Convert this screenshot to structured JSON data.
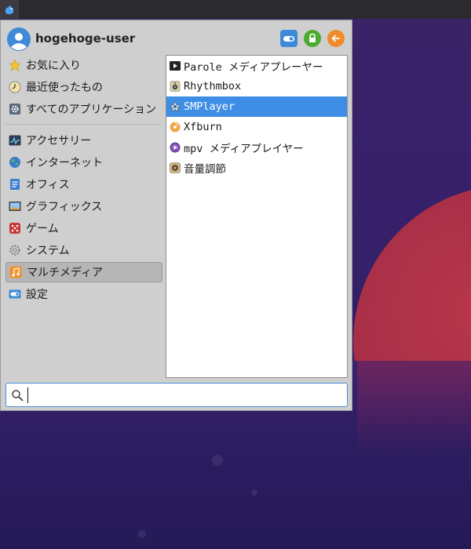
{
  "user": {
    "name": "hogehoge-user"
  },
  "header_buttons": [
    {
      "name": "settings-button",
      "icon": "toggle-icon",
      "color": "#3e8ad8"
    },
    {
      "name": "lock-screen-button",
      "icon": "lock-icon",
      "color": "#4caa2e"
    },
    {
      "name": "logout-button",
      "icon": "arrow-left-icon",
      "color": "#f08a2a"
    }
  ],
  "categories_top": [
    {
      "label": "お気に入り",
      "icon": "star-icon"
    },
    {
      "label": "最近使ったもの",
      "icon": "clock-icon"
    },
    {
      "label": "すべてのアプリケーション",
      "icon": "gear-icon"
    }
  ],
  "categories": [
    {
      "label": "アクセサリー",
      "icon": "accessories-icon"
    },
    {
      "label": "インターネット",
      "icon": "globe-icon"
    },
    {
      "label": "オフィス",
      "icon": "document-icon"
    },
    {
      "label": "グラフィックス",
      "icon": "picture-icon"
    },
    {
      "label": "ゲーム",
      "icon": "dice-icon"
    },
    {
      "label": "システム",
      "icon": "system-gear-icon"
    },
    {
      "label": "マルチメディア",
      "icon": "music-note-icon",
      "active": true
    },
    {
      "label": "設定",
      "icon": "settings-toggle-icon"
    }
  ],
  "apps": [
    {
      "label": "Parole メディアプレーヤー",
      "icon": "play-icon"
    },
    {
      "label": "Rhythmbox",
      "icon": "speaker-icon"
    },
    {
      "label": "SMPlayer",
      "icon": "smplayer-icon",
      "selected": true
    },
    {
      "label": "Xfburn",
      "icon": "disc-icon"
    },
    {
      "label": "mpv メディアプレイヤー",
      "icon": "mpv-icon"
    },
    {
      "label": "音量調節",
      "icon": "volume-icon"
    }
  ],
  "search": {
    "value": "",
    "placeholder": ""
  }
}
